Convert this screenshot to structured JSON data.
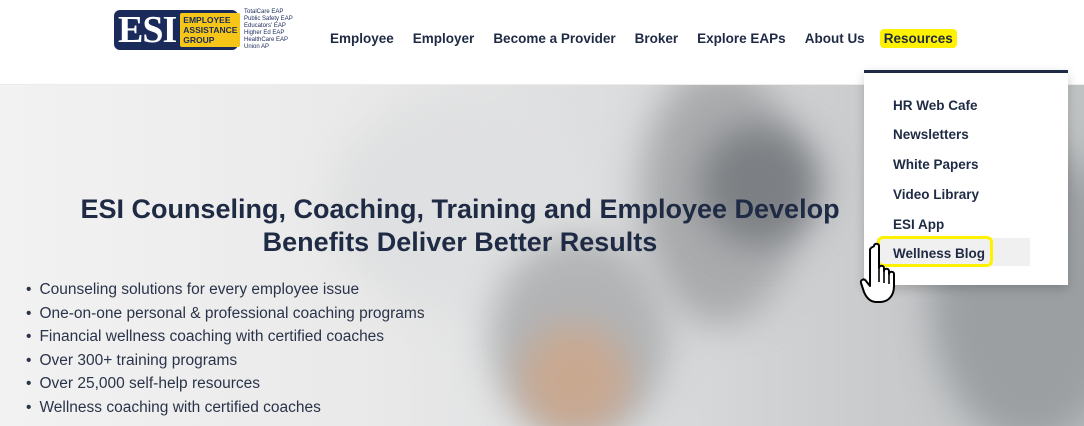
{
  "logo": {
    "mark": "ESI",
    "tag": [
      "EMPLOYEE",
      "ASSISTANCE",
      "GROUP"
    ],
    "programs": [
      "TotalCare EAP",
      "Public Safety EAP",
      "Educators' EAP",
      "Higher Ed EAP",
      "HealthCare EAP",
      "Union AP"
    ]
  },
  "nav": {
    "items": [
      "Employee",
      "Employer",
      "Become a Provider",
      "Broker",
      "Explore EAPs",
      "About Us",
      "Resources"
    ]
  },
  "dropdown": {
    "items": [
      "HR Web Cafe",
      "Newsletters",
      "White Papers",
      "Video Library",
      "ESI App",
      "Wellness Blog"
    ]
  },
  "hero": {
    "title_line1": "ESI Counseling, Coaching, Training and Employee Develop",
    "title_line2": "Benefits Deliver Better Results",
    "bullets": [
      "Counseling solutions for every employee issue",
      "One-on-one personal & professional coaching programs",
      "Financial wellness coaching with certified coaches",
      "Over 300+ training programs",
      "Over 25,000 self-help resources",
      "Wellness coaching with certified coaches"
    ]
  },
  "colors": {
    "navy": "#1f2a44",
    "highlight": "#fff200",
    "logo_blue": "#1a2a5a",
    "logo_gold": "#f5c518"
  },
  "icons": {
    "cursor": "hand-pointer-icon"
  }
}
